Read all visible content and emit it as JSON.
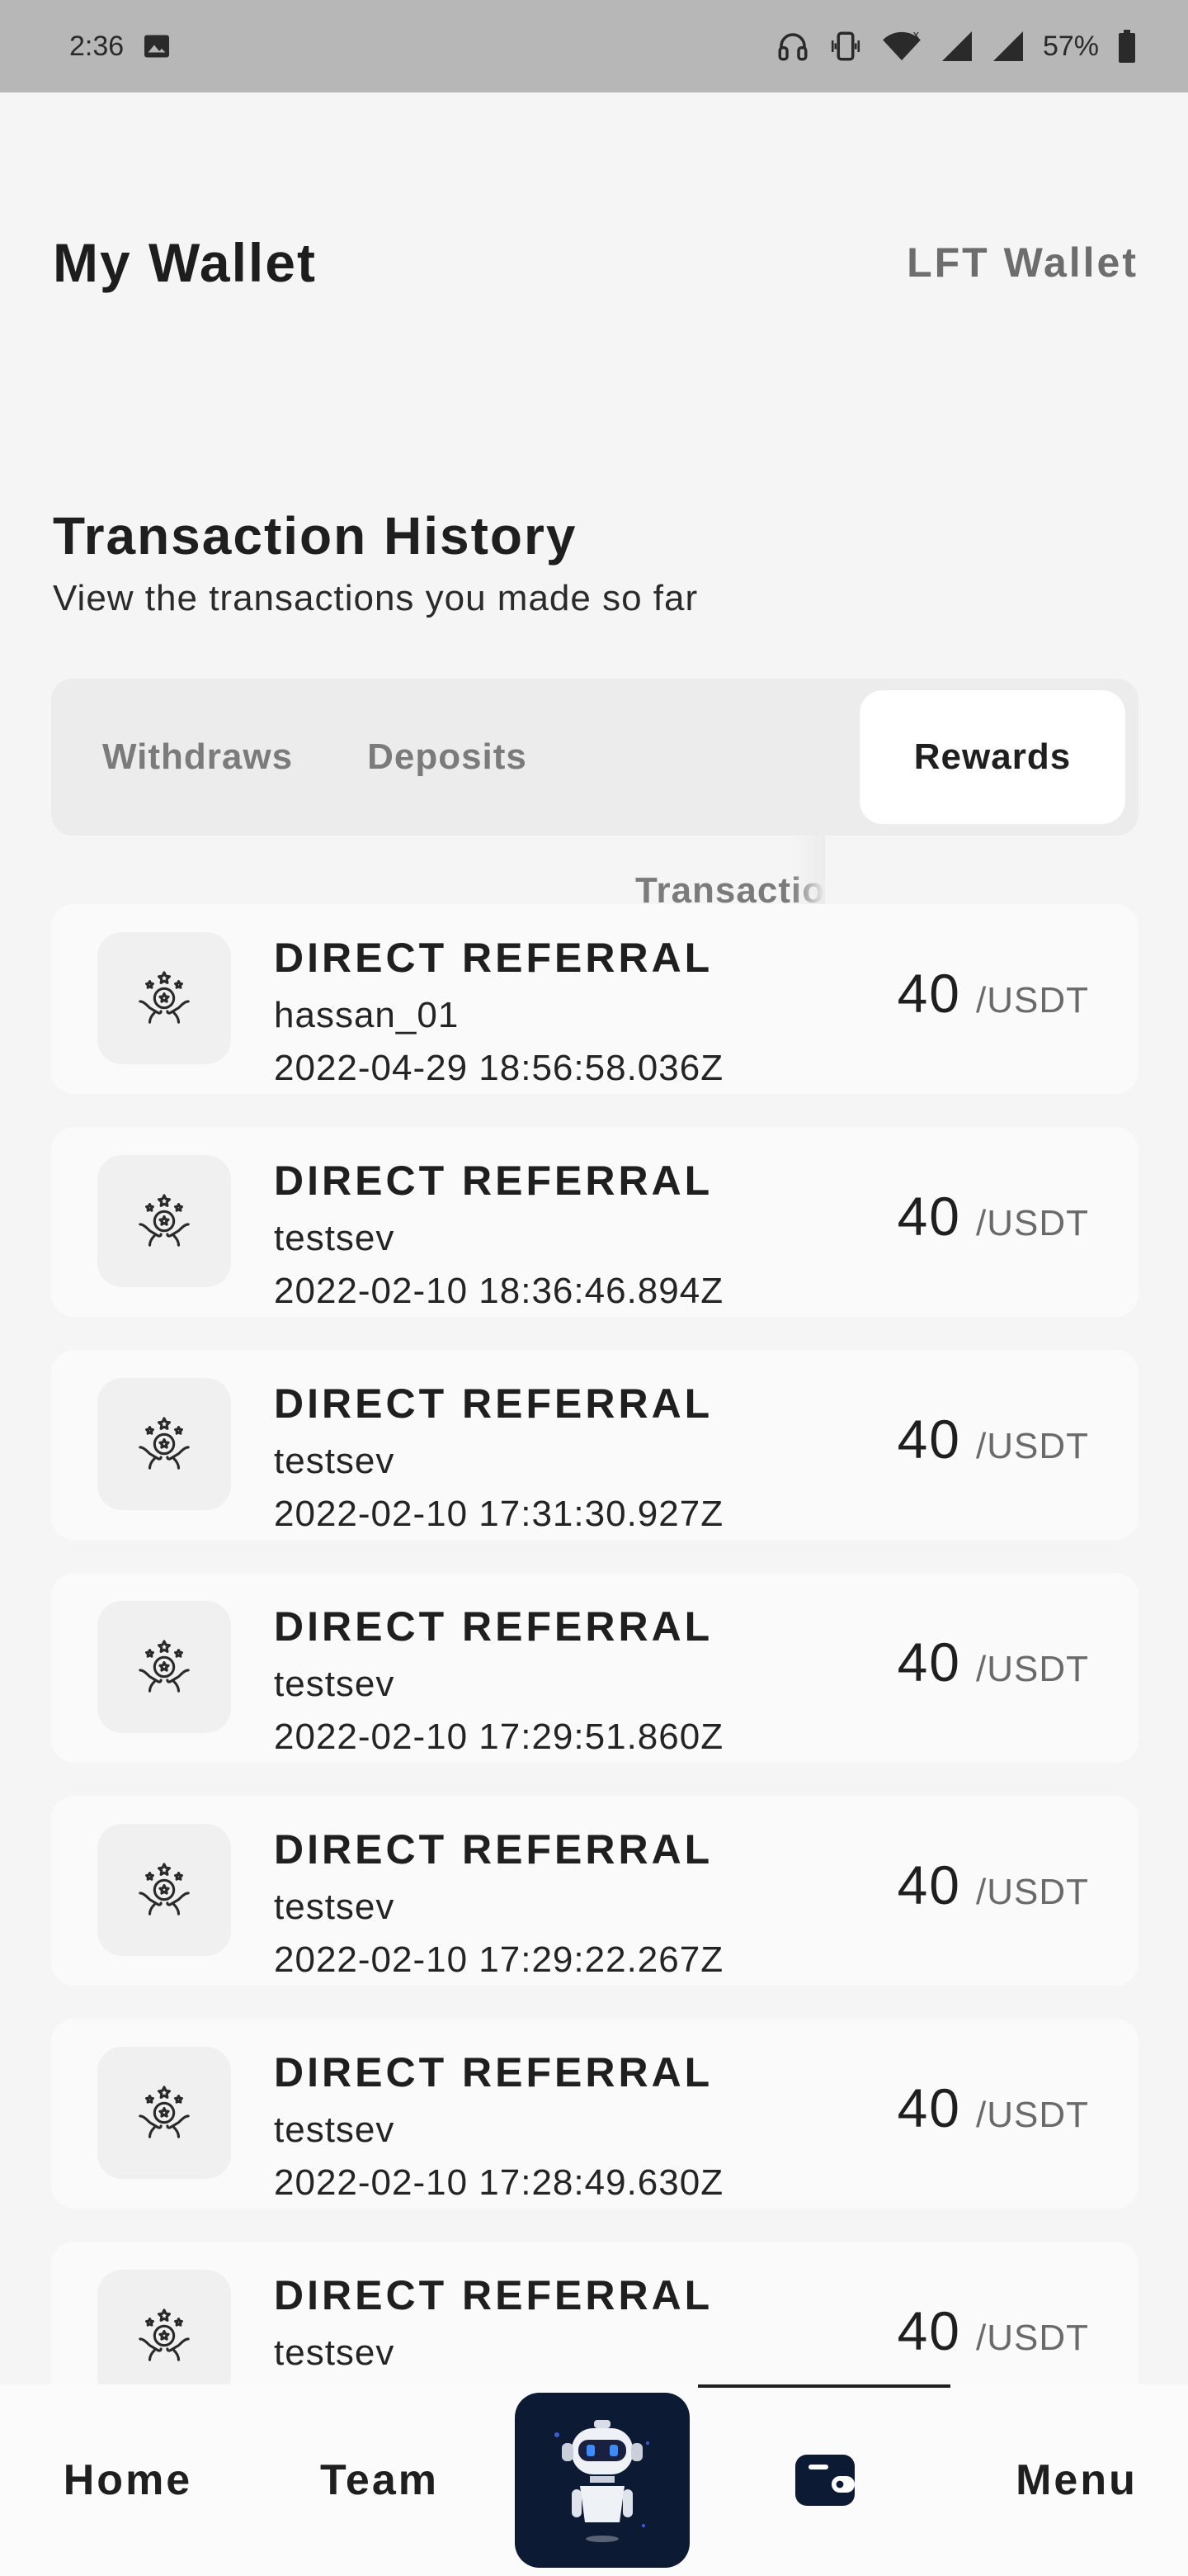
{
  "status_bar": {
    "time": "2:36",
    "battery": "57%",
    "icons": [
      "image-icon",
      "headphones-icon",
      "vibrate-icon",
      "wifi-icon",
      "signal-icon",
      "signal-icon",
      "battery-icon"
    ]
  },
  "header": {
    "title": "My Wallet",
    "wallet_switch": "LFT Wallet"
  },
  "section": {
    "title": "Transaction History",
    "subtitle": "View the transactions you made so far"
  },
  "tabs": [
    {
      "label": "Withdraws",
      "active": false
    },
    {
      "label": "Deposits",
      "active": false
    },
    {
      "label": "Transactions",
      "active": false
    },
    {
      "label": "Rewards",
      "active": true
    }
  ],
  "transactions": [
    {
      "type": "DIRECT REFERRAL",
      "user": "hassan_01",
      "date": "2022-04-29 18:56:58.036Z",
      "amount": "40",
      "unit": "/USDT"
    },
    {
      "type": "DIRECT REFERRAL",
      "user": "testsev",
      "date": "2022-02-10 18:36:46.894Z",
      "amount": "40",
      "unit": "/USDT"
    },
    {
      "type": "DIRECT REFERRAL",
      "user": "testsev",
      "date": "2022-02-10 17:31:30.927Z",
      "amount": "40",
      "unit": "/USDT"
    },
    {
      "type": "DIRECT REFERRAL",
      "user": "testsev",
      "date": "2022-02-10 17:29:51.860Z",
      "amount": "40",
      "unit": "/USDT"
    },
    {
      "type": "DIRECT REFERRAL",
      "user": "testsev",
      "date": "2022-02-10 17:29:22.267Z",
      "amount": "40",
      "unit": "/USDT"
    },
    {
      "type": "DIRECT REFERRAL",
      "user": "testsev",
      "date": "2022-02-10 17:28:49.630Z",
      "amount": "40",
      "unit": "/USDT"
    },
    {
      "type": "DIRECT REFERRAL",
      "user": "testsev",
      "date": "",
      "amount": "40",
      "unit": "/USDT"
    }
  ],
  "bottom_nav": {
    "home": "Home",
    "team": "Team",
    "menu": "Menu",
    "active": "wallet"
  },
  "colors": {
    "status_bar": "#b7b7b7",
    "background": "#f5f5f5",
    "nav_center": "#0c1a34"
  }
}
